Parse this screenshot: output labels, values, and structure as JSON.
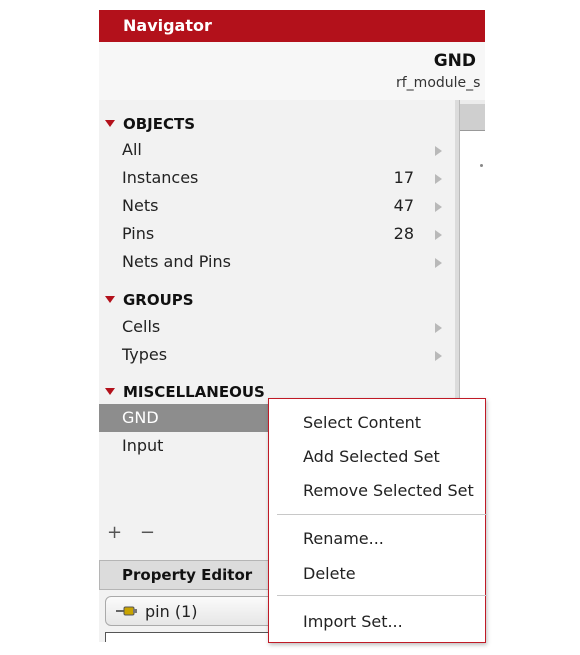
{
  "navigator": {
    "title": "Navigator",
    "selection_title": "GND",
    "selection_subtitle": "rf_module_s"
  },
  "objects": {
    "heading": "OBJECTS",
    "items": [
      {
        "label": "All",
        "count": ""
      },
      {
        "label": "Instances",
        "count": "17"
      },
      {
        "label": "Nets",
        "count": "47"
      },
      {
        "label": "Pins",
        "count": "28"
      },
      {
        "label": "Nets and Pins",
        "count": ""
      }
    ]
  },
  "groups": {
    "heading": "GROUPS",
    "items": [
      {
        "label": "Cells"
      },
      {
        "label": "Types"
      }
    ]
  },
  "miscellaneous": {
    "heading": "MISCELLANEOUS",
    "items": [
      {
        "label": "GND",
        "selected": true
      },
      {
        "label": "Input",
        "selected": false
      }
    ]
  },
  "controls": {
    "add_symbol": "+",
    "remove_symbol": "−"
  },
  "property_editor": {
    "title": "Property Editor",
    "combo_label": "pin (1)",
    "combo_icon": "pin-icon"
  },
  "context_menu": {
    "items": [
      "Select Content",
      "Add Selected Set",
      "Remove Selected Set",
      "Rename...",
      "Delete",
      "Import Set..."
    ]
  },
  "colors": {
    "accent": "#b3111b",
    "selected_row": "#8d8d8d",
    "menu_border": "#c01a26"
  }
}
